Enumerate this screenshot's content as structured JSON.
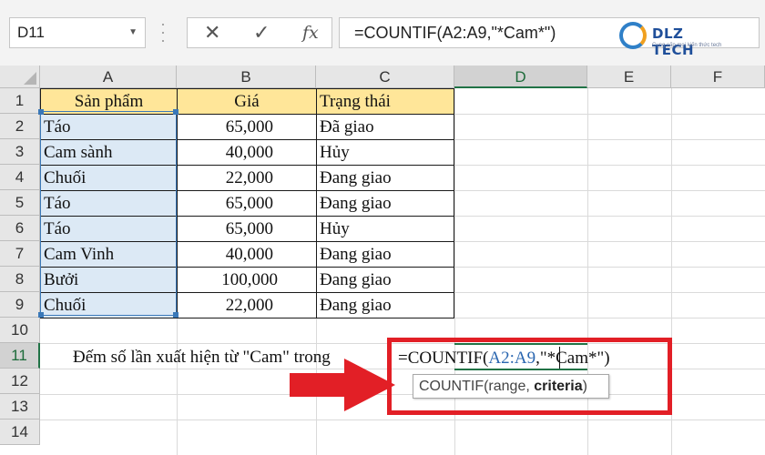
{
  "formula_bar": {
    "name_box": "D11",
    "cancel_icon": "close-icon",
    "enter_icon": "check-icon",
    "fx_label": "fx",
    "formula": "=COUNTIF(A2:A9,\"*Cam*\")"
  },
  "logo": {
    "text": "DLZ TECH",
    "tagline": "Cung cấp mọi kiến thức tech"
  },
  "columns": [
    "A",
    "B",
    "C",
    "D",
    "E",
    "F"
  ],
  "rows": [
    "1",
    "2",
    "3",
    "4",
    "5",
    "6",
    "7",
    "8",
    "9",
    "10",
    "11",
    "12",
    "13",
    "14"
  ],
  "table": {
    "headers": [
      "Sản phẩm",
      "Giá",
      "Trạng thái"
    ],
    "rows": [
      [
        "Táo",
        "65,000",
        "Đã giao"
      ],
      [
        "Cam sành",
        "40,000",
        "Hủy"
      ],
      [
        "Chuối",
        "22,000",
        "Đang giao"
      ],
      [
        "Táo",
        "65,000",
        "Đang giao"
      ],
      [
        "Táo",
        "65,000",
        "Hủy"
      ],
      [
        "Cam Vinh",
        "40,000",
        "Đang giao"
      ],
      [
        "Bưởi",
        "100,000",
        "Đang giao"
      ],
      [
        "Chuối",
        "22,000",
        "Đang giao"
      ]
    ]
  },
  "note": "Đếm số lần xuất hiện từ \"Cam\" trong",
  "cell_formula": {
    "prefix": "=COUNTIF(",
    "ref": "A2:A9",
    "suffix": ",\"*Cam*\")"
  },
  "tooltip": {
    "func": "COUNTIF(range, ",
    "bold": "criteria",
    "close": ")"
  },
  "colors": {
    "header_fill": "#ffe699",
    "range_fill": "#dce9f5",
    "highlight_red": "#e21f26",
    "excel_green": "#217346"
  }
}
